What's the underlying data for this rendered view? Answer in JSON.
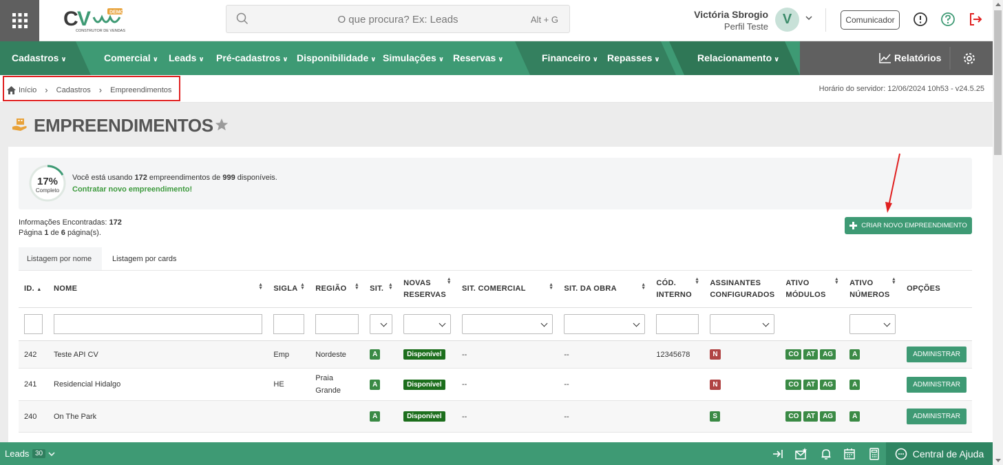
{
  "header": {
    "search_placeholder": "O que procura? Ex: Leads",
    "search_shortcut": "Alt + G",
    "user_name": "Victória Sbrogio",
    "user_profile": "Perfil Teste",
    "avatar_initial": "V",
    "comunicador_label": "Comunicador",
    "logo_text": "CV",
    "logo_badge": "DEMO",
    "logo_subtitle": "CONSTRUTOR DE VENDAS"
  },
  "nav": {
    "items": [
      {
        "label": "Cadastros"
      },
      {
        "label": "Comercial"
      },
      {
        "label": "Leads"
      },
      {
        "label": "Pré-cadastros"
      },
      {
        "label": "Disponibilidade"
      },
      {
        "label": "Simulações"
      },
      {
        "label": "Reservas"
      },
      {
        "label": "Financeiro"
      },
      {
        "label": "Repasses"
      },
      {
        "label": "Relacionamento"
      }
    ],
    "reports_label": "Relatórios"
  },
  "breadcrumb": {
    "items": [
      "Início",
      "Cadastros",
      "Empreendimentos"
    ],
    "server_time": "Horário do servidor: 12/06/2024 10h53 - v24.5.25"
  },
  "page": {
    "title": "EMPREENDIMENTOS"
  },
  "usage": {
    "percent": "17%",
    "percent_value": 17,
    "percent_label": "Completo",
    "text_prefix": "Você está usando ",
    "used": "172",
    "text_middle": " empreendimentos de ",
    "total": "999",
    "text_suffix": " disponíveis.",
    "link": "Contratar novo empreendimento!"
  },
  "results": {
    "found_label": "Informações Encontradas: ",
    "found_count": "172",
    "page_prefix": "Página ",
    "page_current": "1",
    "page_mid": " de ",
    "page_total": "6",
    "page_suffix": " página(s)."
  },
  "actions": {
    "create_label": "CRIAR NOVO EMPREENDIMENTO"
  },
  "tabs": [
    {
      "label": "Listagem por nome"
    },
    {
      "label": "Listagem por cards"
    }
  ],
  "table": {
    "headers": {
      "id": "ID.",
      "nome": "NOME",
      "sigla": "SIGLA",
      "regiao": "REGIÃO",
      "sit": "SIT.",
      "novas_1": "NOVAS",
      "novas_2": "RESERVAS",
      "sit_comercial": "SIT. COMERCIAL",
      "sit_obra": "SIT. DA OBRA",
      "cod_1": "CÓD.",
      "cod_2": "INTERNO",
      "assin_1": "ASSINANTES",
      "assin_2": "CONFIGURADOS",
      "modulos_1": "ATIVO",
      "modulos_2": "MÓDULOS",
      "numeros_1": "ATIVO",
      "numeros_2": "NÚMEROS",
      "opcoes": "OPÇÕES"
    },
    "rows": [
      {
        "id": "242",
        "nome": "Teste API CV",
        "sigla": "Emp",
        "regiao_1": "Nordeste",
        "regiao_2": "",
        "sit": "A",
        "novas": "Disponível",
        "sit_comercial": "--",
        "sit_obra": "--",
        "cod": "12345678",
        "assin": "N",
        "mod1": "CO",
        "mod2": "AT",
        "mod3": "AG",
        "num": "A",
        "action": "ADMINISTRAR"
      },
      {
        "id": "241",
        "nome": "Residencial Hidalgo",
        "sigla": "HE",
        "regiao_1": "Praia",
        "regiao_2": "Grande",
        "sit": "A",
        "novas": "Disponível",
        "sit_comercial": "--",
        "sit_obra": "--",
        "cod": "",
        "assin": "N",
        "mod1": "CO",
        "mod2": "AT",
        "mod3": "AG",
        "num": "A",
        "action": "ADMINISTRAR"
      },
      {
        "id": "240",
        "nome": "On The Park",
        "sigla": "",
        "regiao_1": "",
        "regiao_2": "",
        "sit": "A",
        "novas": "Disponível",
        "sit_comercial": "--",
        "sit_obra": "--",
        "cod": "",
        "assin": "S",
        "mod1": "CO",
        "mod2": "AT",
        "mod3": "AG",
        "num": "A",
        "action": "ADMINISTRAR"
      }
    ]
  },
  "bottombar": {
    "leads_label": "Leads",
    "leads_count": "30",
    "help_label": "Central de Ajuda"
  },
  "colors": {
    "primary": "#3e9a74",
    "nav_dark": "#34805f",
    "badge_green": "#3a8a45",
    "badge_red": "#b04444",
    "logout_red": "#e02020"
  }
}
